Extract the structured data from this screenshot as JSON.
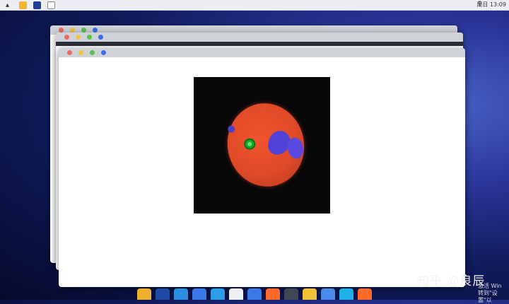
{
  "topbar": {
    "clock": "周日 13:09",
    "search_icon": "magnifier-icon",
    "launcher_icon": "launcher-icon",
    "app_icons": [
      "folder-icon",
      "browser-icon",
      "document-icon"
    ]
  },
  "windows": [
    {
      "id": "back",
      "controls": [
        "close",
        "minimize",
        "maximize",
        "extra"
      ]
    },
    {
      "id": "middle",
      "controls": [
        "close",
        "minimize",
        "maximize",
        "extra"
      ]
    },
    {
      "id": "front",
      "controls": [
        "close",
        "minimize",
        "maximize",
        "extra"
      ]
    }
  ],
  "image_view": {
    "description_color_scheme": {
      "background": "#080808",
      "cell": "#e04a28",
      "nuclei": "#5042d8",
      "marker": "#17a62c"
    }
  },
  "dock": {
    "icons": [
      {
        "name": "files-icon",
        "color": "#f0b030"
      },
      {
        "name": "terminal-icon",
        "color": "#1e4aa8"
      },
      {
        "name": "store-icon",
        "color": "#2b8fe0"
      },
      {
        "name": "code-icon",
        "color": "#3a78e8"
      },
      {
        "name": "mail-icon",
        "color": "#2c9de8"
      },
      {
        "name": "settings-icon",
        "color": "#eef0f4"
      },
      {
        "name": "network-icon",
        "color": "#3a7ae8"
      },
      {
        "name": "vpn-icon",
        "color": "#ff6a28"
      },
      {
        "name": "calculator-icon",
        "color": "#404652"
      },
      {
        "name": "notes-icon",
        "color": "#f0c038"
      },
      {
        "name": "tools-icon",
        "color": "#4a8ae8"
      },
      {
        "name": "shield-icon",
        "color": "#20b0e8"
      },
      {
        "name": "share-icon",
        "color": "#ff6a28"
      }
    ]
  },
  "watermark": {
    "text": "知乎 @良辰"
  },
  "activation": {
    "line1": "激活 Win",
    "line2": "转到\"设置\"以"
  }
}
